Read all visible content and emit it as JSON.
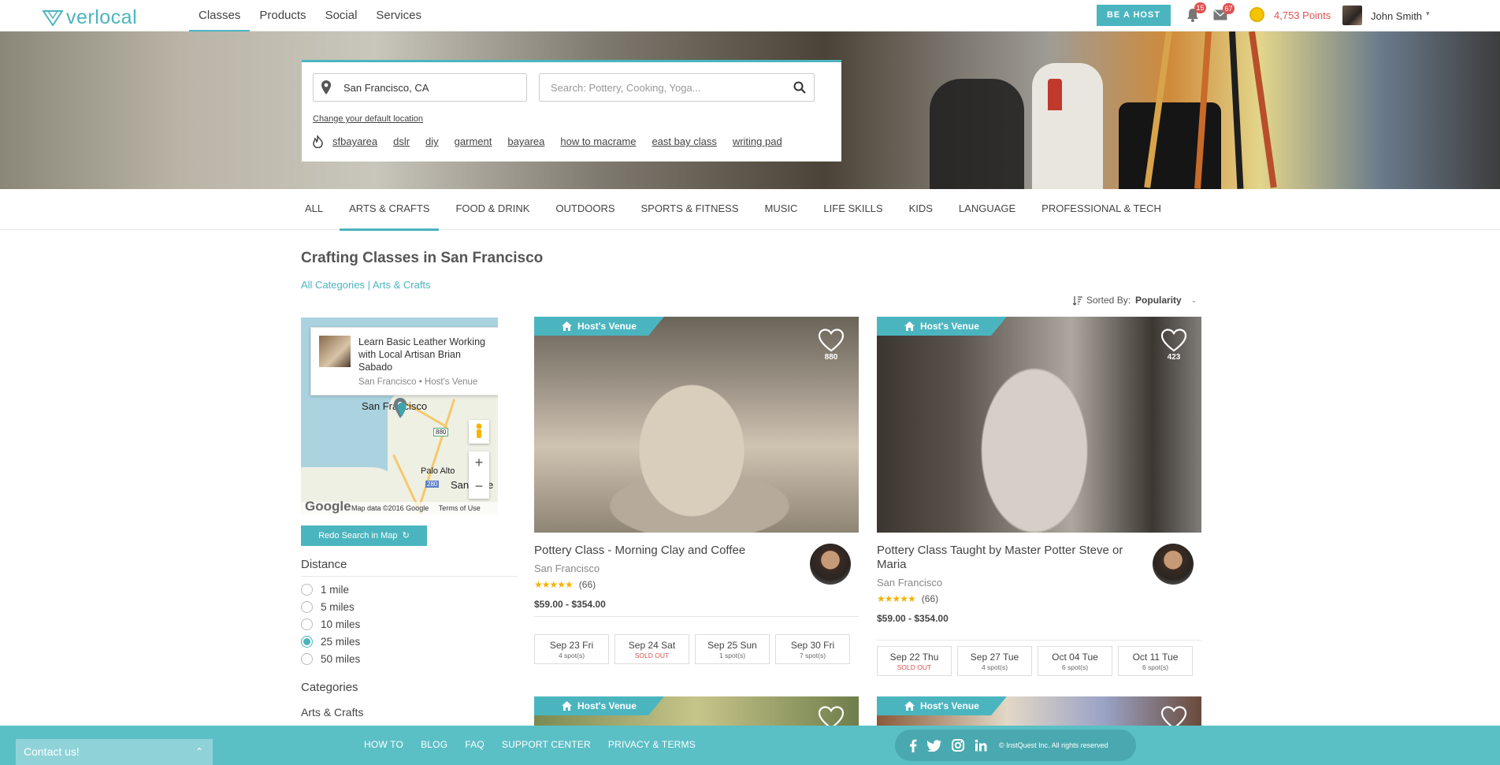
{
  "header": {
    "logo_text": "verlocal",
    "nav": [
      {
        "label": "Classes",
        "active": true
      },
      {
        "label": "Products",
        "active": false
      },
      {
        "label": "Social",
        "active": false
      },
      {
        "label": "Services",
        "active": false
      }
    ],
    "be_host_label": "BE A HOST",
    "notifications_count": "15",
    "messages_count": "67",
    "points_label": "4,753 Points",
    "user_name": "John Smith",
    "accent_color": "#4bb5bf"
  },
  "search": {
    "location_value": "San Francisco, CA",
    "query_placeholder": "Search: Pottery, Cooking, Yoga...",
    "change_location_label": "Change your default location",
    "trending_tags": [
      "sfbayarea",
      "dslr",
      "diy",
      "garment",
      "bayarea",
      "how to macrame",
      "east bay class",
      "writing pad"
    ]
  },
  "category_tabs": [
    {
      "label": "ALL",
      "active": false
    },
    {
      "label": "ARTS & CRAFTS",
      "active": true
    },
    {
      "label": "FOOD & DRINK",
      "active": false
    },
    {
      "label": "OUTDOORS",
      "active": false
    },
    {
      "label": "SPORTS & FITNESS",
      "active": false
    },
    {
      "label": "MUSIC",
      "active": false
    },
    {
      "label": "LIFE SKILLS",
      "active": false
    },
    {
      "label": "KIDS",
      "active": false
    },
    {
      "label": "LANGUAGE",
      "active": false
    },
    {
      "label": "PROFESSIONAL & TECH",
      "active": false
    }
  ],
  "page": {
    "title": "Crafting Classes in San Francisco",
    "breadcrumb_all": "All Categories",
    "breadcrumb_sep": "|",
    "breadcrumb_current": "Arts & Crafts",
    "sort_label": "Sorted By:",
    "sort_value": "Popularity"
  },
  "map": {
    "popup_title": "Learn Basic Leather Working with Local Artisan Brian Sabado",
    "popup_subtitle": "San Francisco • Host's Venue",
    "label_sf": "San Francisco",
    "label_palo_alto": "Palo Alto",
    "label_san_jose": "San Jose",
    "highway_880": "880",
    "highway_280": "280",
    "attribution": "Map data ©2016 Google",
    "terms": "Terms of Use",
    "google_logo": "Google",
    "zoom_in": "+",
    "zoom_out": "−",
    "redo_label": "Redo Search in Map"
  },
  "filters": {
    "distance_heading": "Distance",
    "distance_options": [
      {
        "label": "1 mile",
        "selected": false
      },
      {
        "label": "5 miles",
        "selected": false
      },
      {
        "label": "10 miles",
        "selected": false
      },
      {
        "label": "25 miles",
        "selected": true
      },
      {
        "label": "50 miles",
        "selected": false
      }
    ],
    "categories_heading": "Categories",
    "category_first": "Arts & Crafts"
  },
  "listings": [
    {
      "badge": "Host's Venue",
      "favorites": "880",
      "title": "Pottery Class - Morning Clay and Coffee",
      "city": "San Francisco",
      "rating_stars": 5,
      "reviews": "(66)",
      "price": "$59.00 - $354.00",
      "dates": [
        {
          "date": "Sep 23 Fri",
          "spots": "4 spot(s)",
          "sold_out": false
        },
        {
          "date": "Sep 24 Sat",
          "spots": "SOLD OUT",
          "sold_out": true
        },
        {
          "date": "Sep 25 Sun",
          "spots": "1 spot(s)",
          "sold_out": false
        },
        {
          "date": "Sep 30 Fri",
          "spots": "7 spot(s)",
          "sold_out": false
        }
      ]
    },
    {
      "badge": "Host's Venue",
      "favorites": "423",
      "title": "Pottery Class Taught by Master Potter Steve or Maria",
      "city": "San Francisco",
      "rating_stars": 5,
      "reviews": "(66)",
      "price": "$59.00 - $354.00",
      "dates": [
        {
          "date": "Sep 22 Thu",
          "spots": "SOLD OUT",
          "sold_out": true
        },
        {
          "date": "Sep 27 Tue",
          "spots": "4 spot(s)",
          "sold_out": false
        },
        {
          "date": "Oct 04 Tue",
          "spots": "6 spot(s)",
          "sold_out": false
        },
        {
          "date": "Oct 11 Tue",
          "spots": "6 spot(s)",
          "sold_out": false
        }
      ]
    },
    {
      "badge": "Host's Venue"
    },
    {
      "badge": "Host's Venue"
    }
  ],
  "footer": {
    "contact_label": "Contact us!",
    "links": [
      "HOW TO",
      "BLOG",
      "FAQ",
      "SUPPORT CENTER",
      "PRIVACY & TERMS"
    ],
    "copyright": "© InstQuest Inc. All rights reserved"
  }
}
